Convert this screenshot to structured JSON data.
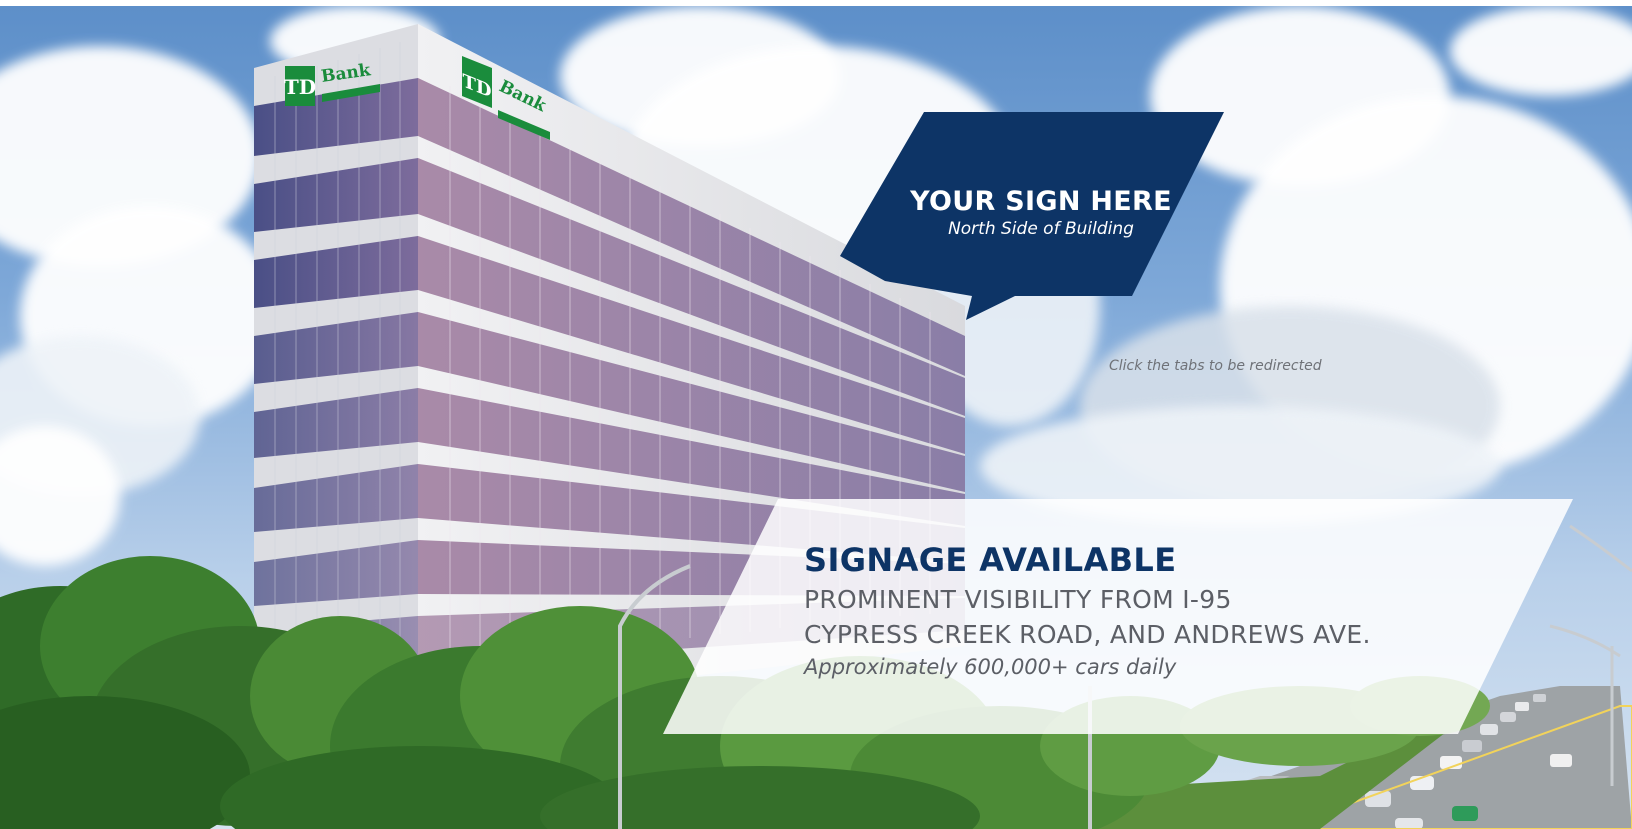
{
  "sign_callout": {
    "title": "YOUR SIGN HERE",
    "subtitle": "North Side of Building"
  },
  "hint_text": "Click the tabs to be redirected",
  "signage": {
    "title": "SIGNAGE AVAILABLE",
    "line1": "PROMINENT VISIBILITY FROM I-95",
    "line2": "CYPRESS CREEK ROAD, AND ANDREWS AVE.",
    "note": "Approximately 600,000+ cars daily"
  },
  "building_signs": [
    {
      "logo": "TD",
      "name": "Bank"
    },
    {
      "logo": "TD",
      "name": "Bank"
    }
  ],
  "colors": {
    "navy": "#0d3466",
    "td_green": "#1a8c3c",
    "panel_white": "rgba(255,255,255,0.88)"
  }
}
